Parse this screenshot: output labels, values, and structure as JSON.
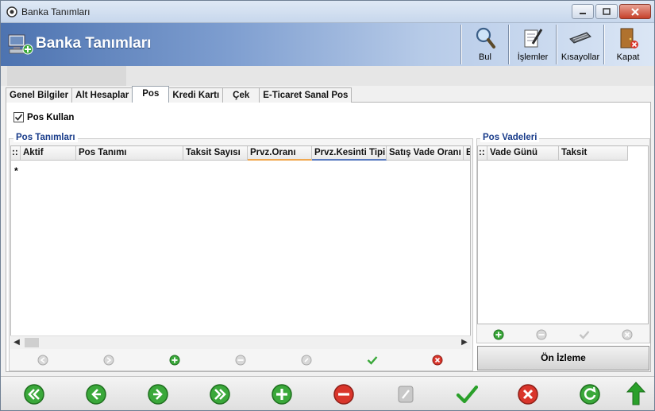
{
  "window": {
    "title": "Banka Tanımları"
  },
  "header": {
    "title": "Banka Tanımları"
  },
  "toolbar": {
    "bul": "Bul",
    "islemler": "İşlemler",
    "kisayollar": "Kısayollar",
    "kapat": "Kapat"
  },
  "tabs": [
    "Genel Bilgiler",
    "Alt Hesaplar",
    "Pos",
    "Kredi Kartı",
    "Çek",
    "E-Ticaret Sanal Pos"
  ],
  "pos_kullan": {
    "label": "Pos Kullan",
    "checked": true
  },
  "pos_tanimlari": {
    "title": "Pos Tanımları",
    "row_marker": "*",
    "columns": [
      "::",
      "Aktif",
      "Pos Tanımı",
      "Taksit Sayısı",
      "Prvz.Oranı",
      "Prvz.Kesinti Tipi",
      "Satış Vade Oranı",
      "B"
    ]
  },
  "pos_vadeleri": {
    "title": "Pos Vadeleri",
    "columns": [
      "::",
      "Vade Günü",
      "Taksit"
    ]
  },
  "on_izleme": "Ön İzleme",
  "colors": {
    "accent": "#4d73b0",
    "group_title": "#183b8a",
    "go_green": "#2aa02a",
    "stop_red": "#d32f2f"
  }
}
